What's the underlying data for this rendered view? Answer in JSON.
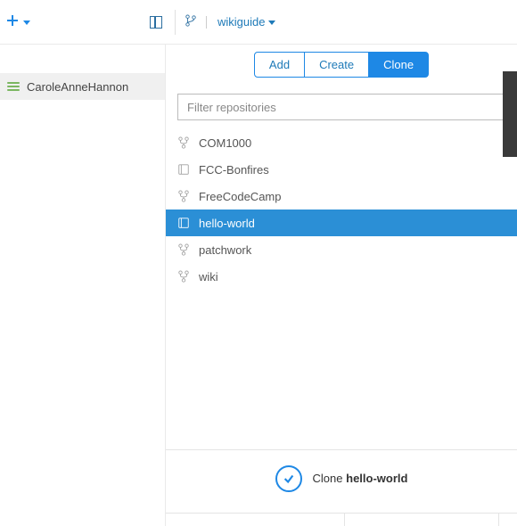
{
  "topbar": {
    "repo_dropdown_label": "wikiguide"
  },
  "sidebar": {
    "username": "CaroleAnneHannon"
  },
  "tabs": [
    {
      "label": "Add",
      "active": false
    },
    {
      "label": "Create",
      "active": false
    },
    {
      "label": "Clone",
      "active": true
    }
  ],
  "filter": {
    "placeholder": "Filter repositories",
    "value": ""
  },
  "repos": [
    {
      "name": "COM1000",
      "icon": "fork",
      "selected": false
    },
    {
      "name": "FCC-Bonfires",
      "icon": "book",
      "selected": false
    },
    {
      "name": "FreeCodeCamp",
      "icon": "fork",
      "selected": false
    },
    {
      "name": "hello-world",
      "icon": "book",
      "selected": true
    },
    {
      "name": "patchwork",
      "icon": "fork",
      "selected": false
    },
    {
      "name": "wiki",
      "icon": "fork",
      "selected": false
    }
  ],
  "footer": {
    "action_word": "Clone",
    "target_repo": "hello-world"
  }
}
